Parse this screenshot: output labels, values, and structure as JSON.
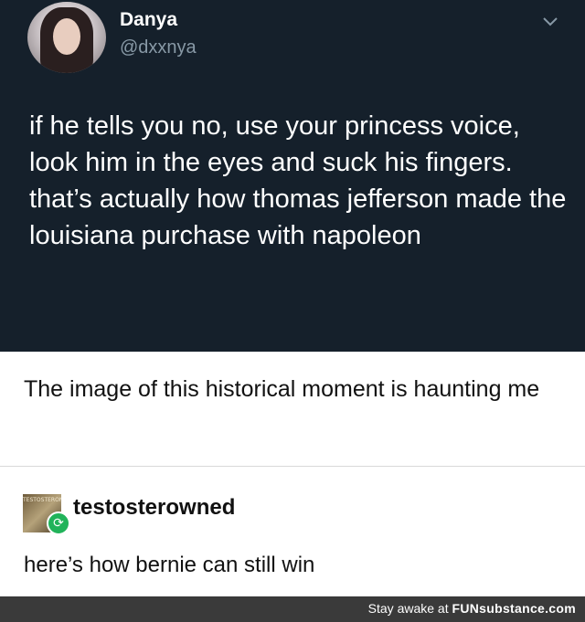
{
  "tweet": {
    "display_name": "Danya",
    "handle": "@dxxnya",
    "text": "if he tells you no, use your princess voice, look him in the eyes and suck his fingers. that’s actually how thomas jefferson made the louisiana purchase with napoleon",
    "menu_icon": "chevron-down-icon",
    "colors": {
      "background": "#15202b",
      "handle": "#8899a6"
    }
  },
  "reply_1": {
    "text": "The image of this historical moment is haunting me"
  },
  "reply_2": {
    "username": "testosterowned",
    "avatar_text": "TESTOSTERONE",
    "reblog_icon": "reblog-icon",
    "text": "here’s how bernie can still win",
    "colors": {
      "reblog": "#21b35a"
    }
  },
  "footer": {
    "prefix": "Stay awake at ",
    "brand": "FUNsubstance.com",
    "colors": {
      "background": "#3a3a3a"
    }
  }
}
